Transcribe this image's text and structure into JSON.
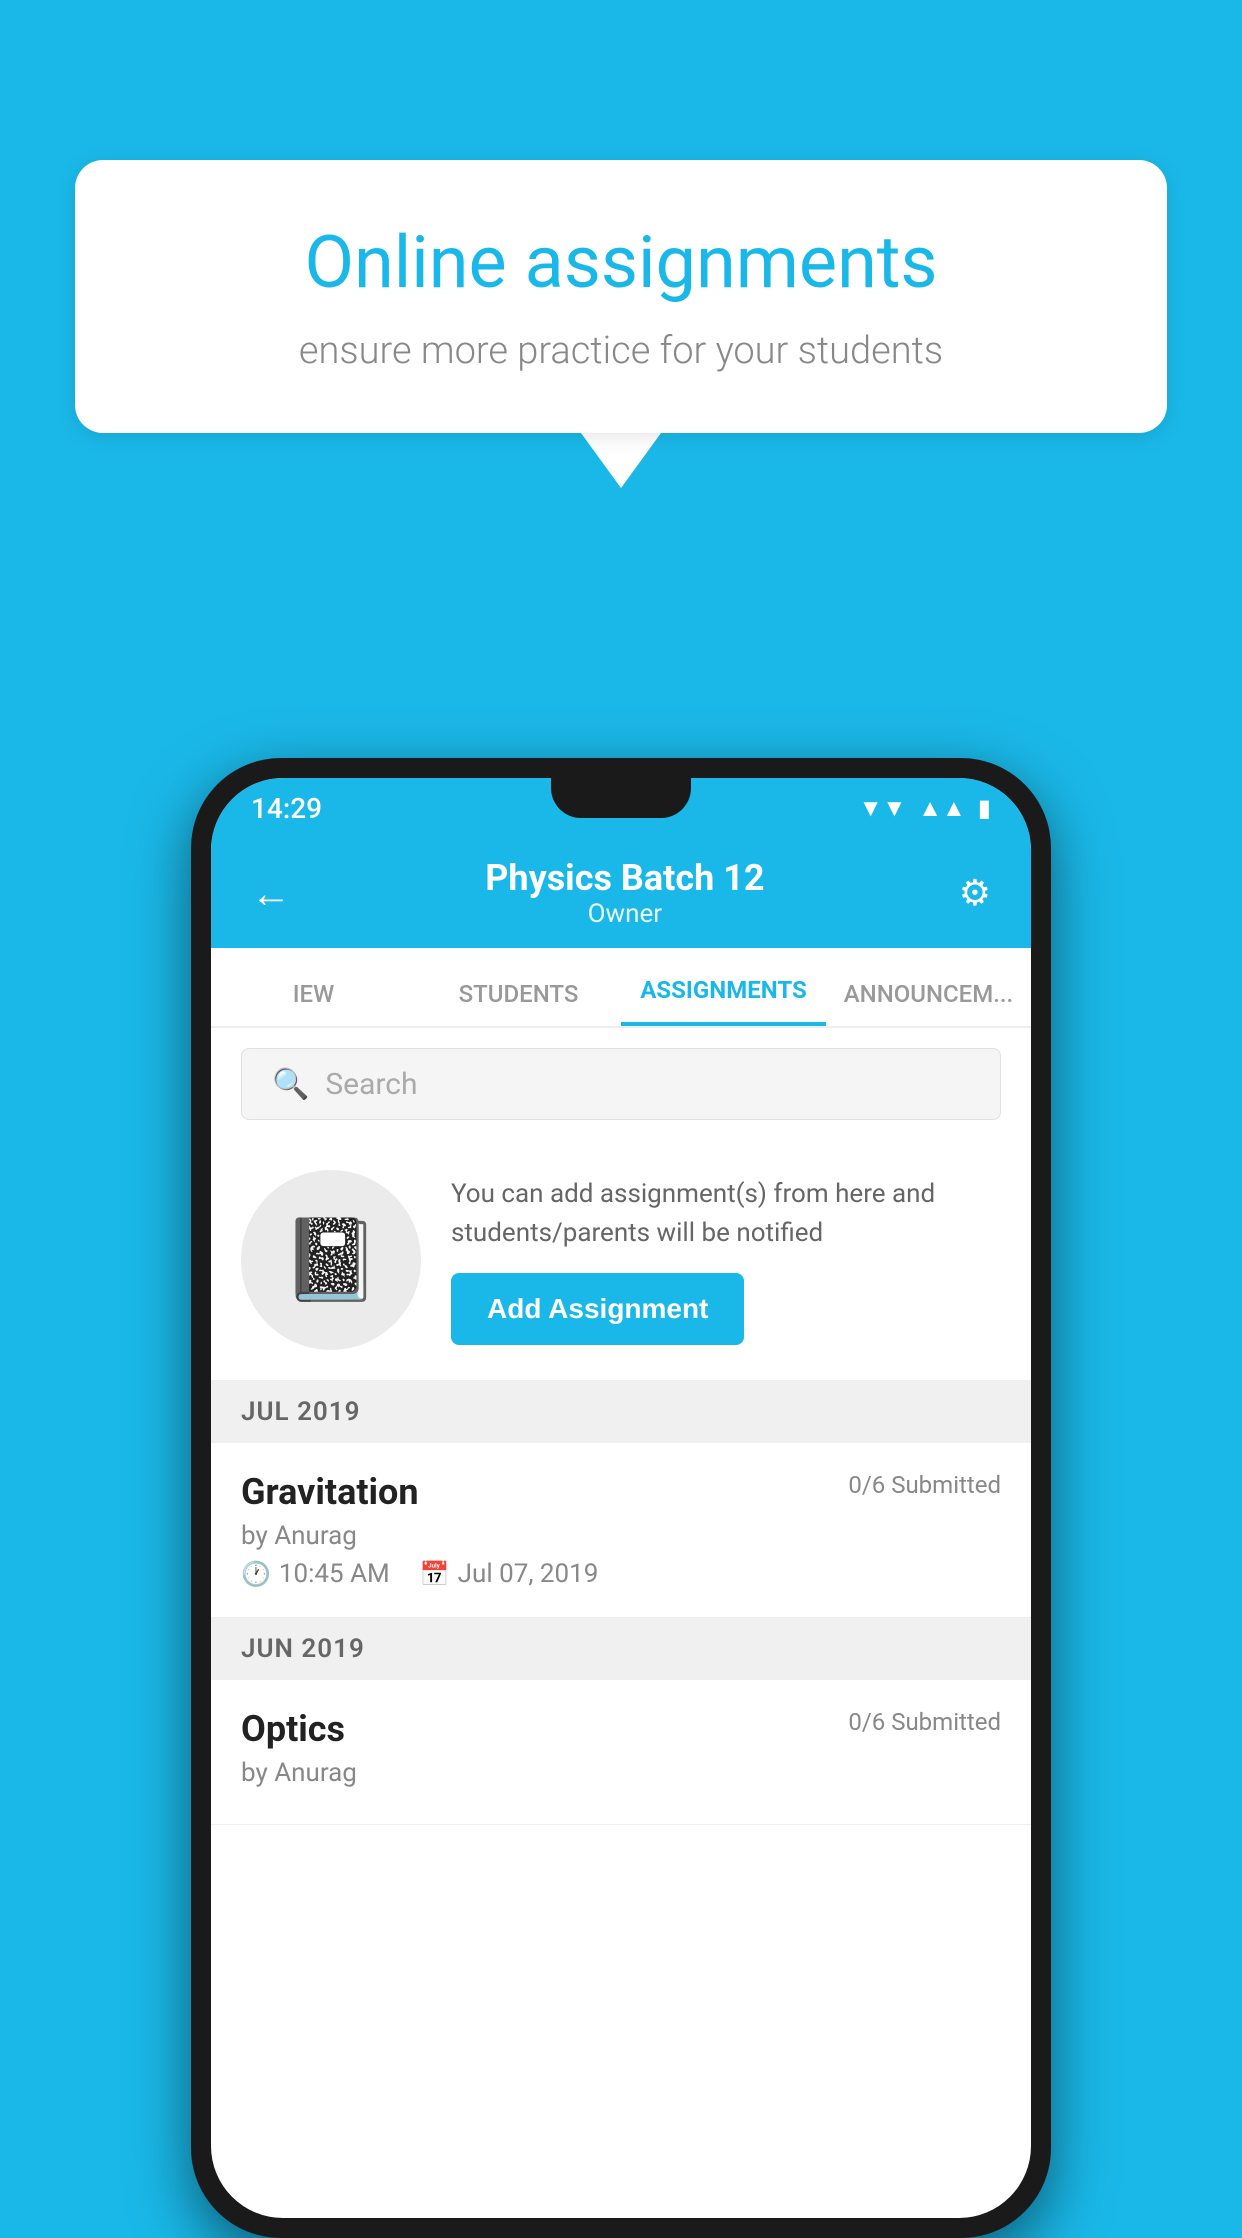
{
  "background": {
    "color": "#1ab8e8"
  },
  "speech_bubble": {
    "title": "Online assignments",
    "subtitle": "ensure more practice for your students"
  },
  "status_bar": {
    "time": "14:29",
    "wifi_icon": "▼",
    "signal_icon": "▲",
    "battery_icon": "▮"
  },
  "header": {
    "title": "Physics Batch 12",
    "subtitle": "Owner",
    "back_label": "←",
    "settings_label": "⚙"
  },
  "tabs": [
    {
      "label": "IEW",
      "active": false
    },
    {
      "label": "STUDENTS",
      "active": false
    },
    {
      "label": "ASSIGNMENTS",
      "active": true
    },
    {
      "label": "ANNOUNCEM...",
      "active": false
    }
  ],
  "search": {
    "placeholder": "Search"
  },
  "add_assignment": {
    "description": "You can add assignment(s) from here and students/parents will be notified",
    "button_label": "Add Assignment"
  },
  "sections": [
    {
      "label": "JUL 2019",
      "assignments": [
        {
          "name": "Gravitation",
          "submitted": "0/6 Submitted",
          "author": "by Anurag",
          "time": "10:45 AM",
          "date": "Jul 07, 2019"
        }
      ]
    },
    {
      "label": "JUN 2019",
      "assignments": [
        {
          "name": "Optics",
          "submitted": "0/6 Submitted",
          "author": "by Anurag",
          "time": "",
          "date": ""
        }
      ]
    }
  ]
}
